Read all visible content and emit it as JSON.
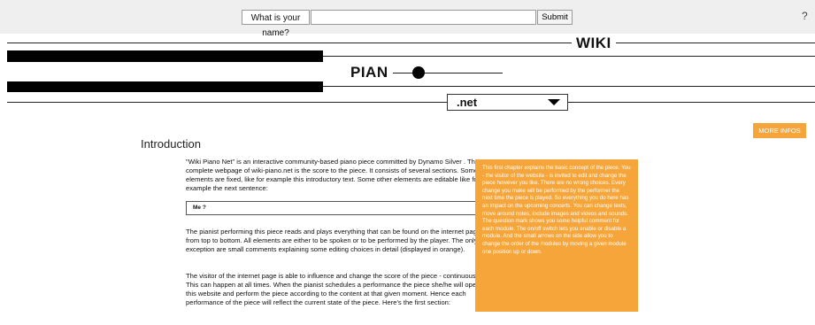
{
  "topbar": {
    "name_prompt": "What is your name?",
    "name_value": "",
    "submit_label": "Submit",
    "help_label": "?"
  },
  "header": {
    "wiki": "WIKI",
    "pian": "PIAN",
    "dropdown_selected": ".net"
  },
  "more_infos_label": "MORE INFOS",
  "intro": {
    "title": "Introduction",
    "para1": "\"Wiki Piano Net\" is an interactive community-based piano piece committed by Dynamo Silver . The complete webpage of wiki-piano.net is the score to the piece. It consists of several sections. Some elements are fixed, like for example this introductory text. Some other elements are editable like for example the next sentence:",
    "editable_text": "Me ?",
    "para2": "The pianist performing this piece reads and plays everything that can be found on the internet page, from top to bottom. All elements are either to be spoken or to be performed by the player. The only exception are small comments explaining some editing choices in detail (displayed in orange).",
    "para3": "The visitor of the internet page is able to influence and change the score of the piece - continuously. This can happen at all times. When the pianist schedules a performance the piece she/he will open this website and perform the piece according to the content at that given moment. Hence each performance of the piece will reflect the current state of the piece. Here's the first section:"
  },
  "note": {
    "text": "This first chapter explains the basic concept of the piece. You - the visitor of the website - is invited to edit and change the piece however you like. There are no wrong choices. Every change you make will be performed by the performer the next time the piece is played. So everything you do here has an impact on the upcoming concerts. You can change texts, move around notes, include images and videos and sounds. The question mark shows you some helpful comment for each module. The on/off switch lets you enable or disable a module. And the small arrows on the side allow you to change the order of the modules by moving a given module one position up or down."
  },
  "colors": {
    "accent_orange": "#f5a53a",
    "topbar_bg": "#efefef"
  }
}
